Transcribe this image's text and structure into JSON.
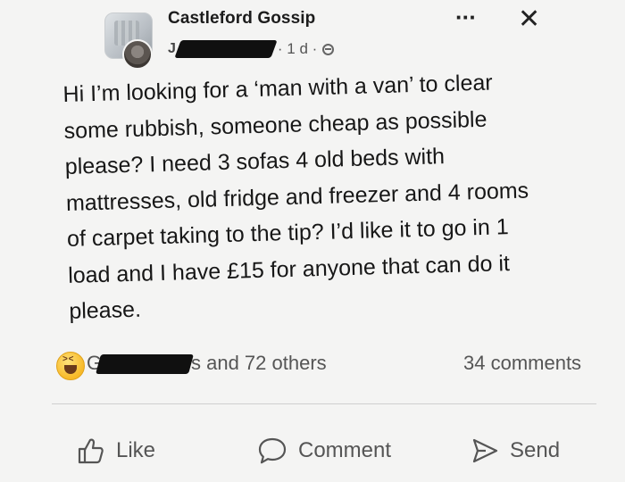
{
  "post": {
    "page_name": "Castleford Gossip",
    "author_initial": "J",
    "time": "· 1 d ·",
    "body_lines": [
      "Hi I’m looking for a ‘man with a van’ to clear",
      "some rubbish, someone cheap as possible",
      "please? I need 3 sofas 4 old beds with",
      "mattresses, old fridge and freezer and 4 rooms",
      "of carpet taking to the tip? I’d like it to go in 1",
      "load and I have £15 for anyone that can do it",
      "please."
    ]
  },
  "header_icons": {
    "more": "more-options-icon",
    "close": "close-icon",
    "privacy": "globe-icon"
  },
  "reactions": {
    "reaction_icon": "haha-icon",
    "reactor_initial": "G",
    "text": "s and 72 others",
    "comments": "34 comments"
  },
  "actions": {
    "like": "Like",
    "comment": "Comment",
    "send": "Send"
  }
}
